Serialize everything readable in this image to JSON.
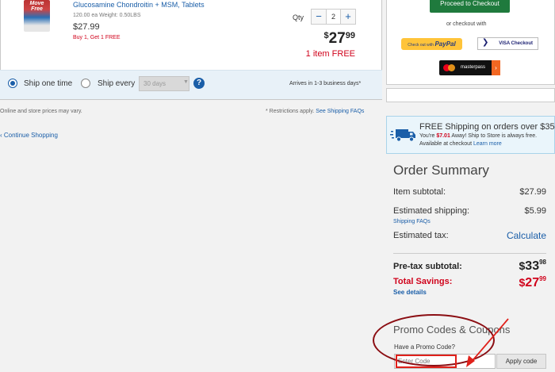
{
  "product": {
    "name": "Glucosamine Chondroitin + MSM, Tablets",
    "thumb_brand": "Move Free",
    "meta": "120.00 ea   Weight: 0.50LBS",
    "unit_price": "$27.99",
    "promo": "Buy 1, Get 1 FREE",
    "qty_label": "Qty",
    "qty_minus": "−",
    "qty_value": "2",
    "qty_plus": "+",
    "total_currency": "$",
    "total_dollars": "27",
    "total_cents": "99",
    "free_items": "1 item FREE"
  },
  "shipping_options": {
    "one_time_label": "Ship one time",
    "every_label": "Ship every",
    "frequency_value": "30 days",
    "help_icon_glyph": "?",
    "arrives": "Arrives in 1-3 business days*"
  },
  "notes": {
    "online_prices": "Online and store prices may vary.",
    "restrictions": "* Restrictions apply.",
    "shipping_faqs_link": "See Shipping FAQs",
    "continue_shopping": "‹ Continue Shopping"
  },
  "checkout": {
    "proceed_button": "Proceed to Checkout",
    "or_text": "or checkout with",
    "paypal_prefix": "Check out with",
    "paypal_brand": "PayPal",
    "visa_label": "VISA Checkout",
    "masterpass_label": "masterpass",
    "masterpass_arrow": "›"
  },
  "free_shipping": {
    "title": "FREE Shipping on orders over $35",
    "away_prefix": "You're",
    "away_amount": "$7.01",
    "away_suffix": "Away! Ship to Store is always free.",
    "available": "Available at checkout",
    "learn_more": "Learn more"
  },
  "order_summary": {
    "title": "Order Summary",
    "item_subtotal_label": "Item subtotal:",
    "item_subtotal_value": "$27.99",
    "est_shipping_label": "Estimated shipping:",
    "est_shipping_value": "$5.99",
    "shipping_faqs": "Shipping FAQs",
    "est_tax_label": "Estimated tax:",
    "est_tax_value": "Calculate",
    "pretax_label": "Pre-tax subtotal:",
    "pretax_currency": "$",
    "pretax_dollars": "33",
    "pretax_cents": "98",
    "savings_label": "Total Savings:",
    "savings_currency": "$",
    "savings_dollars": "27",
    "savings_cents": "99",
    "see_details": "See details"
  },
  "promo": {
    "title": "Promo Codes & Coupons",
    "question": "Have a Promo Code?",
    "placeholder": "Enter Code",
    "apply_button": "Apply code"
  },
  "icons": {
    "truck": "truck-icon",
    "help": "help-icon",
    "chevron": "chevron-down-icon"
  },
  "colors": {
    "link": "#1a5ea8",
    "sale_red": "#d0021b",
    "checkout_green": "#1f7a3d",
    "annotation_dark_red": "#8b0e13",
    "annotation_red": "#e0201a"
  }
}
